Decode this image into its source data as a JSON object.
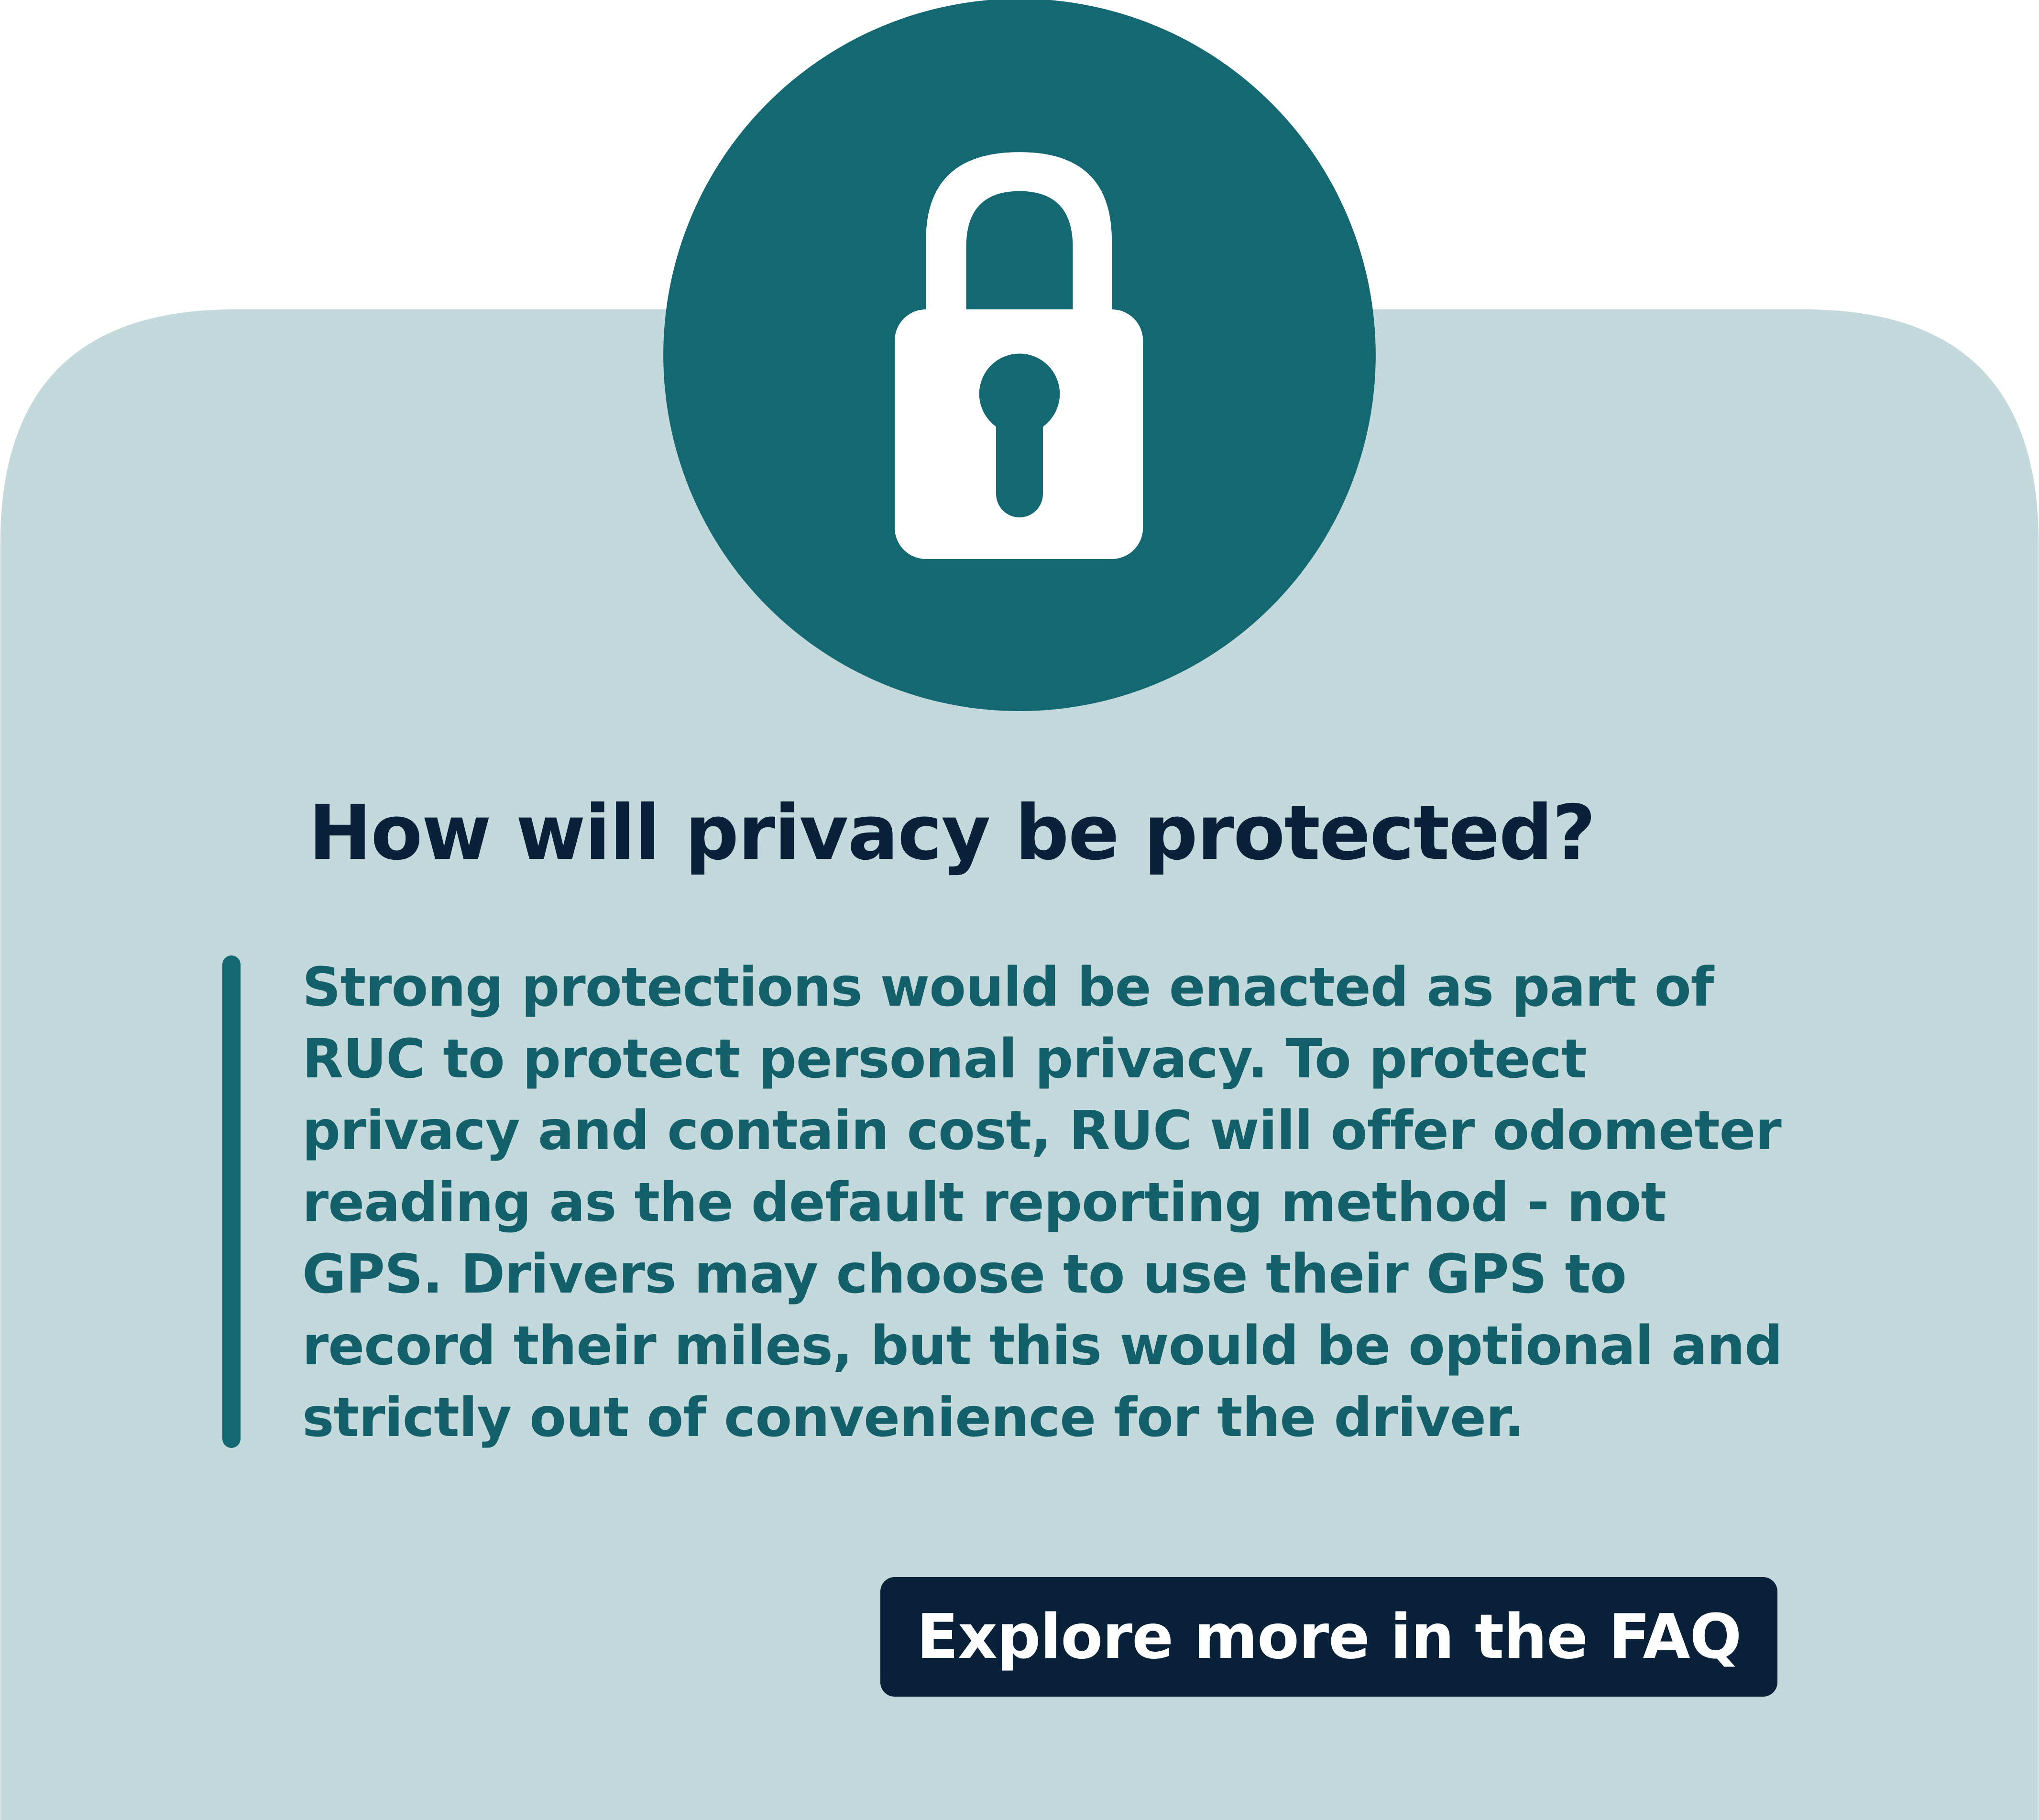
{
  "colors": {
    "card": "#c3d9dc",
    "accent": "#146872",
    "navy": "#0a213a",
    "body_text": "#13606b"
  },
  "icon": "lock-icon",
  "title": "How will privacy be protected?",
  "body_lines": [
    "Strong protections would be enacted as part of",
    "RUC to protect personal privacy. To protect",
    "privacy and contain cost, RUC will offer odometer",
    "reading as the default reporting method - not",
    "GPS. Drivers may choose to use their GPS to",
    "record their miles, but this would be optional and",
    "strictly out of convenience for the driver."
  ],
  "button_label": "Explore more in the FAQ"
}
